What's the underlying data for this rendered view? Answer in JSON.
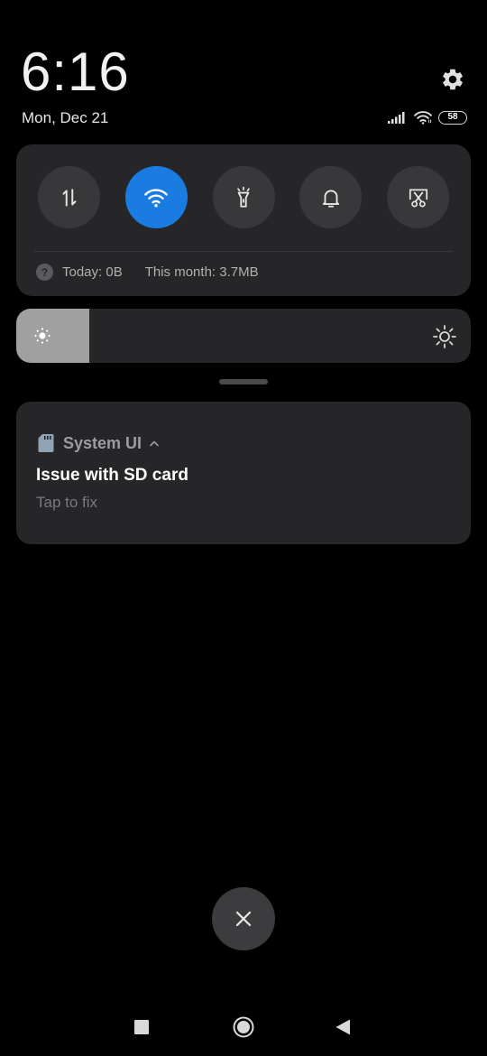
{
  "status": {
    "time": "6:16",
    "date": "Mon, Dec 21",
    "battery": "58"
  },
  "icons": {
    "settings": "gear-icon",
    "signal": "cellular-signal-icon",
    "wifi_status": "wifi-icon",
    "battery": "battery-icon"
  },
  "quick_settings": {
    "toggles": [
      {
        "name": "mobile-data",
        "icon": "data-transfer-icon",
        "active": false
      },
      {
        "name": "wifi",
        "icon": "wifi-icon",
        "active": true
      },
      {
        "name": "flashlight",
        "icon": "flashlight-icon",
        "active": false
      },
      {
        "name": "sound",
        "icon": "bell-icon",
        "active": false
      },
      {
        "name": "screenshot",
        "icon": "screenshot-scissors-icon",
        "active": false
      }
    ],
    "data_usage": {
      "today": "Today: 0B",
      "month": "This month: 3.7MB",
      "help_glyph": "?"
    },
    "accent_color": "#1a7be0"
  },
  "brightness": {
    "level": 0.16
  },
  "notification": {
    "app_name": "System UI",
    "app_icon": "sd-card-icon",
    "title": "Issue with SD card",
    "text": "Tap to fix"
  },
  "actions": {
    "clear_all_icon": "close-icon"
  },
  "navbar": {
    "recents_icon": "recents-square-icon",
    "home_icon": "home-circle-icon",
    "back_icon": "back-triangle-icon"
  }
}
